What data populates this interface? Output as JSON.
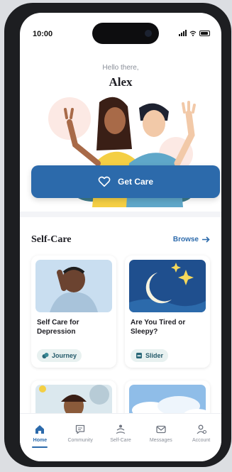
{
  "status_bar": {
    "time": "10:00"
  },
  "hero": {
    "greeting": "Hello there,",
    "name": "Alex"
  },
  "get_care": {
    "label": "Get Care"
  },
  "self_care": {
    "title": "Self-Care",
    "browse_label": "Browse",
    "cards": [
      {
        "title": "Self Care for Depression",
        "tag": "Journey"
      },
      {
        "title": "Are You Tired or Sleepy?",
        "tag": "Slider"
      }
    ]
  },
  "tabs": [
    {
      "label": "Home",
      "icon": "home-icon",
      "active": true
    },
    {
      "label": "Community",
      "icon": "chat-icon",
      "active": false
    },
    {
      "label": "Self-Care",
      "icon": "selfcare-icon",
      "active": false
    },
    {
      "label": "Messages",
      "icon": "mail-icon",
      "active": false
    },
    {
      "label": "Account",
      "icon": "account-icon",
      "active": false
    }
  ],
  "colors": {
    "primary": "#2c6aab",
    "tag_bg": "#e8f1f0",
    "tag_text": "#245a6a"
  }
}
